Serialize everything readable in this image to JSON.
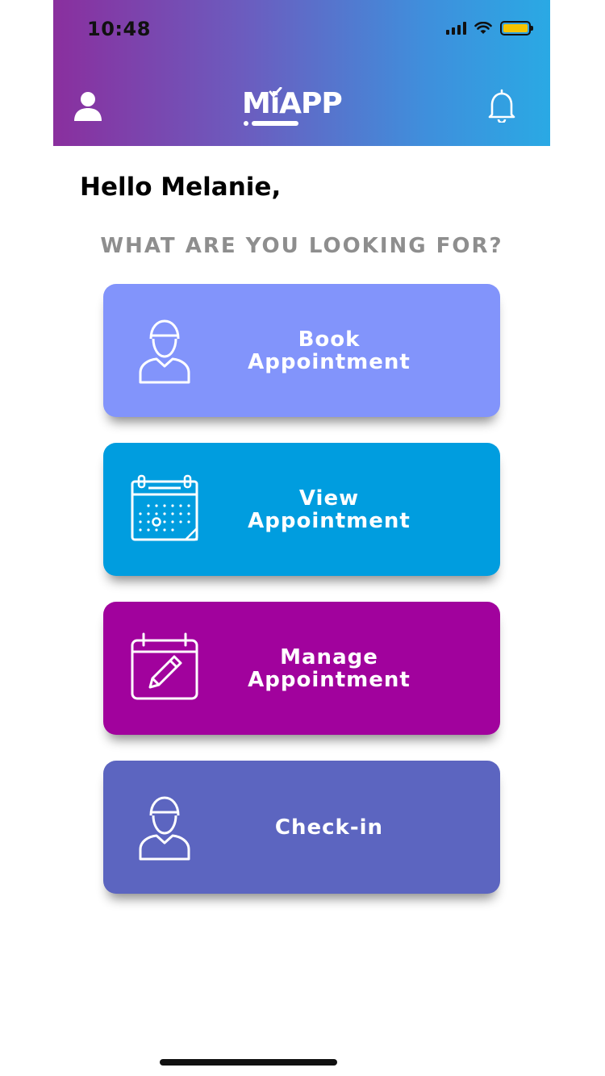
{
  "status_bar": {
    "time": "10:48",
    "battery_color": "#f5c400"
  },
  "header": {
    "logo_text": "MiAPP",
    "gradient": [
      "#8a2f9e",
      "#2aa9e4"
    ],
    "icons": [
      "profile-icon",
      "bell-icon"
    ]
  },
  "greeting": "Hello Melanie,",
  "prompt": "WHAT ARE YOU LOOKING FOR?",
  "cards": [
    {
      "label": "Book Appointment",
      "icon": "doctor-icon",
      "color": "#8294fb"
    },
    {
      "label": "View Appointment",
      "icon": "calendar-icon",
      "color": "#009ddf"
    },
    {
      "label": "Manage Appointment",
      "icon": "calendar-edit-icon",
      "color": "#a1029d"
    },
    {
      "label": "Check-in",
      "icon": "doctor-icon",
      "color": "#5c65c0"
    }
  ]
}
